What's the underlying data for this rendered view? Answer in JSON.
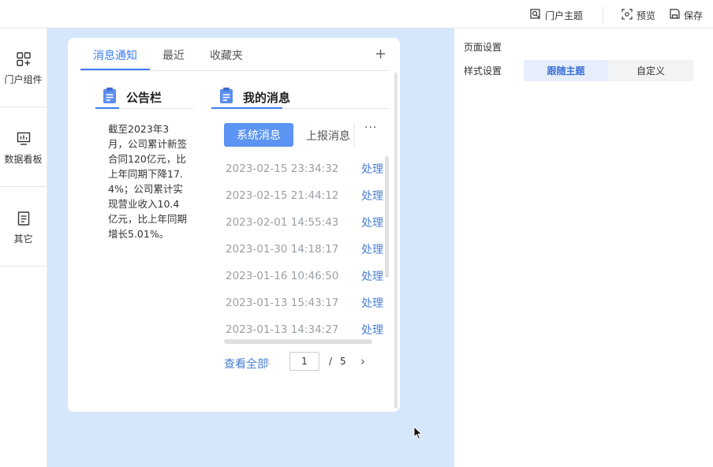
{
  "topbar": {
    "theme_label": "门户主题",
    "preview_label": "预览",
    "save_label": "保存"
  },
  "sidebar": {
    "items": [
      {
        "label": "门户组件",
        "icon": "grid-icon"
      },
      {
        "label": "数据看板",
        "icon": "dashboard-icon"
      },
      {
        "label": "其它",
        "icon": "document-icon"
      }
    ]
  },
  "card": {
    "tabs": [
      "消息通知",
      "最近",
      "收藏夹"
    ],
    "active_tab": "消息通知",
    "add_symbol": "+",
    "bulletin": {
      "title": "公告栏",
      "text": "截至2023年3月，公司累计新签合同120亿元，比上年同期下降17.4%；公司累计实现营业收入10.4亿元，比上年同期增长5.01%。"
    },
    "messages": {
      "title": "我的消息",
      "buttons": {
        "system": "系统消息",
        "report": "上报消息",
        "more": "···"
      },
      "rows": [
        {
          "time": "2023-02-15 23:34:32",
          "action": "处理"
        },
        {
          "time": "2023-02-15 21:44:12",
          "action": "处理"
        },
        {
          "time": "2023-02-01 14:55:43",
          "action": "处理"
        },
        {
          "time": "2023-01-30 14:18:17",
          "action": "处理"
        },
        {
          "time": "2023-01-16 10:46:50",
          "action": "处理"
        },
        {
          "time": "2023-01-13 15:43:17",
          "action": "处理"
        },
        {
          "time": "2023-01-13 14:34:27",
          "action": "处理"
        }
      ],
      "view_all": "查看全部",
      "pagination": {
        "prev": "‹",
        "current": "1",
        "slash": "/",
        "total": "5",
        "next": "›"
      }
    }
  },
  "right_panel": {
    "page_settings": "页面设置",
    "style_settings": "样式设置",
    "options": [
      "跟随主题",
      "自定义"
    ],
    "selected": "跟随主题"
  },
  "colors": {
    "accent": "#3b7cf0",
    "canvas_bg": "#d6e6fb",
    "primary_button": "#5b94f2"
  }
}
